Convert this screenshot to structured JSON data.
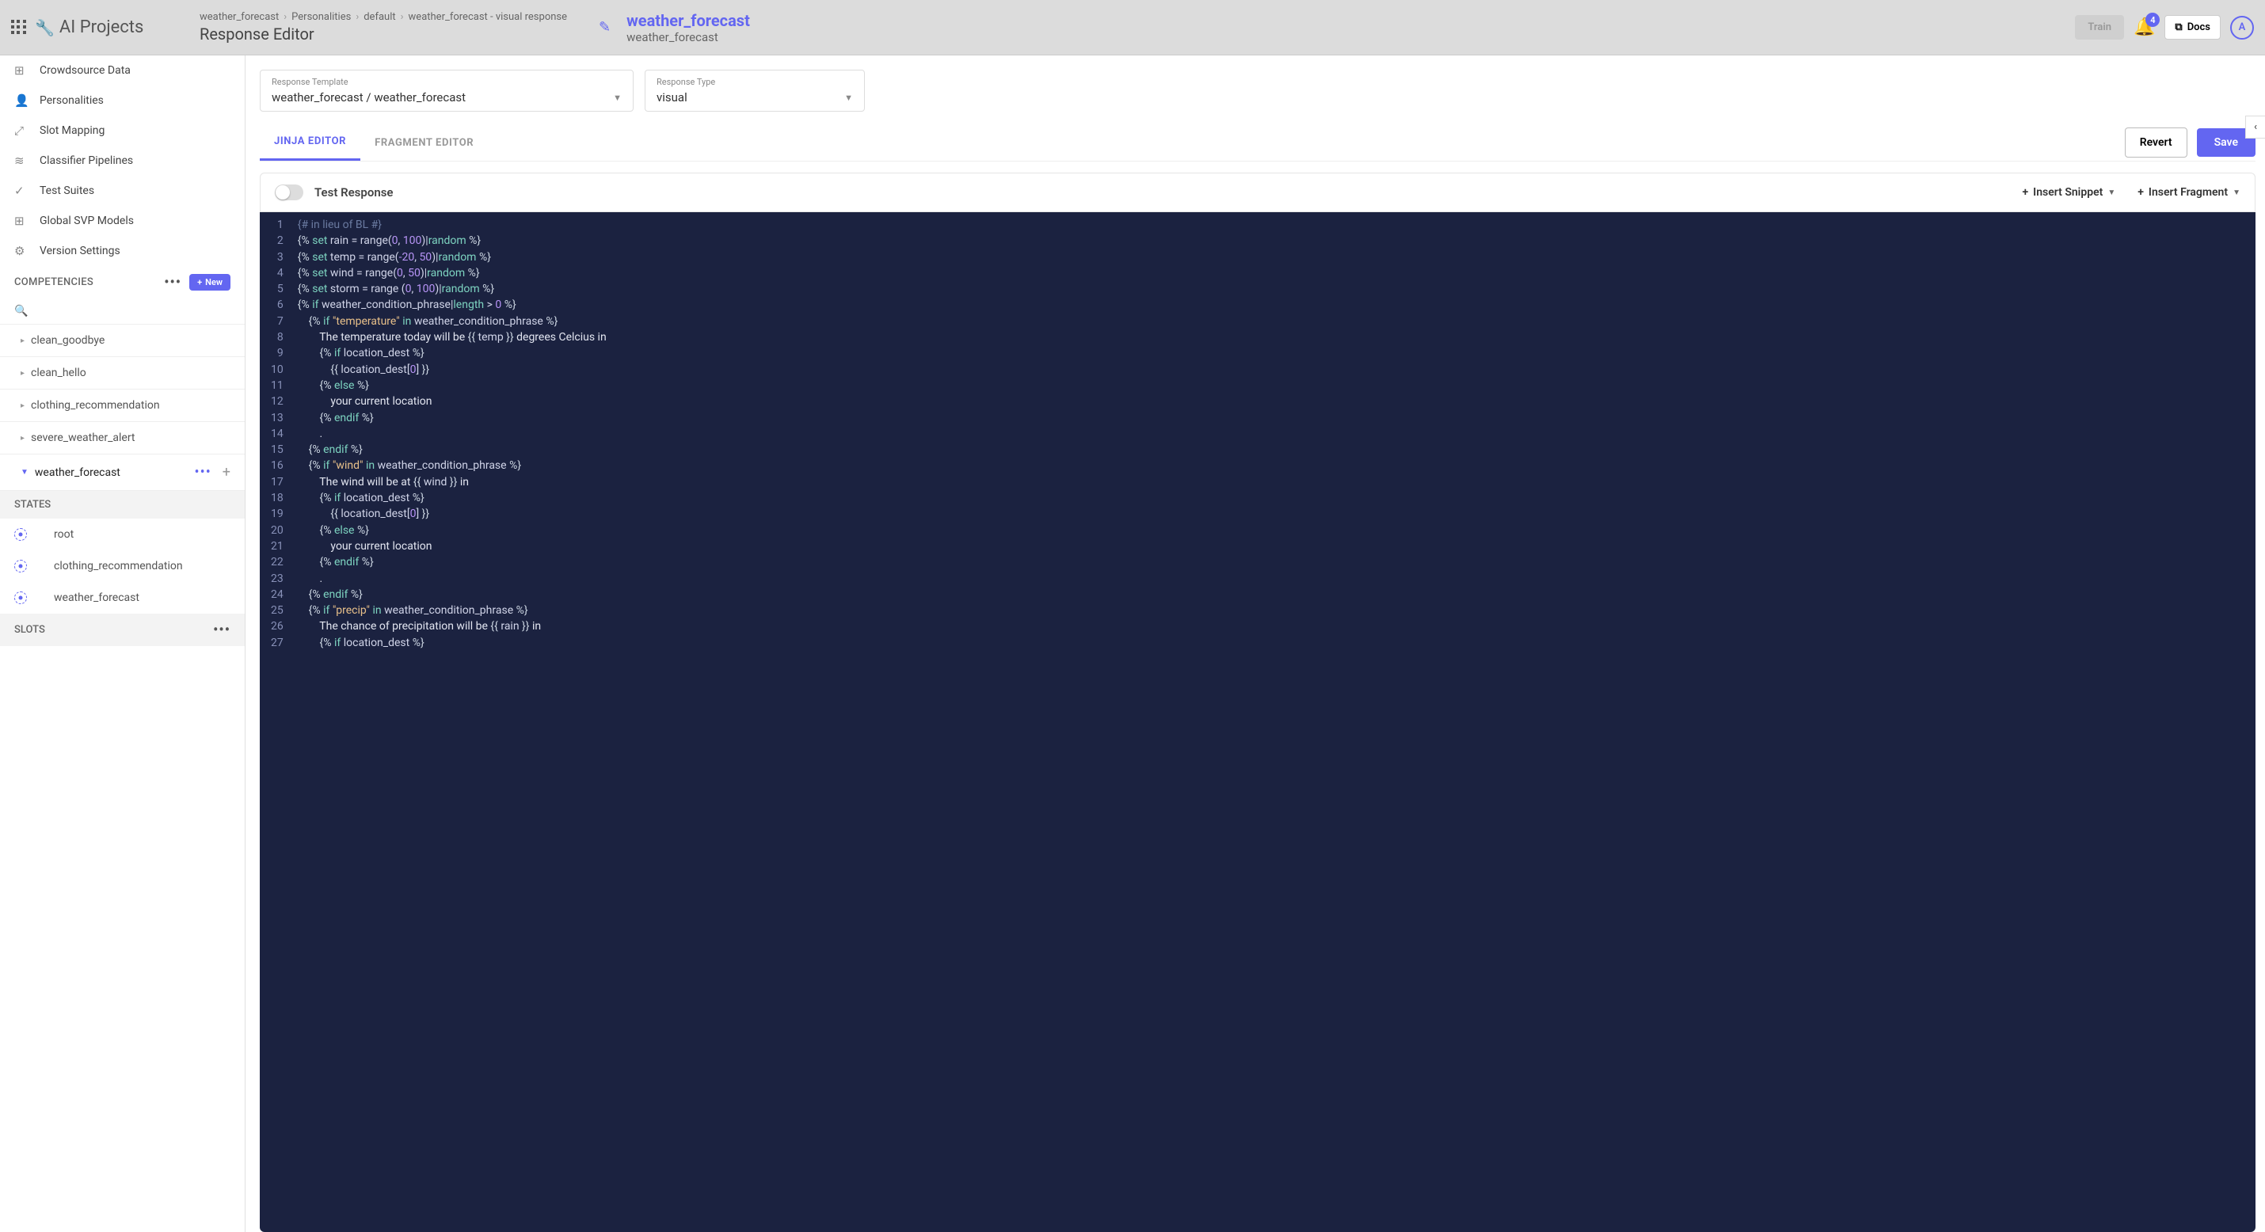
{
  "brand": "AI Projects",
  "breadcrumb": [
    "weather_forecast",
    "Personalities",
    "default",
    "weather_forecast - visual response"
  ],
  "page_title": "Response Editor",
  "wf": {
    "title": "weather_forecast",
    "sub": "weather_forecast"
  },
  "header": {
    "train": "Train",
    "docs": "Docs",
    "bell_badge": "4",
    "avatar": "A"
  },
  "sidebar": {
    "nav": [
      {
        "icon": "⊞",
        "label": "Crowdsource Data"
      },
      {
        "icon": "👤",
        "label": "Personalities"
      },
      {
        "icon": "⤢",
        "label": "Slot Mapping"
      },
      {
        "icon": "≋",
        "label": "Classifier Pipelines"
      },
      {
        "icon": "✓",
        "label": "Test Suites"
      },
      {
        "icon": "⊞",
        "label": "Global SVP Models"
      },
      {
        "icon": "⚙",
        "label": "Version Settings"
      }
    ],
    "competencies_label": "COMPETENCIES",
    "new_label": "New",
    "competencies": [
      {
        "label": "clean_goodbye",
        "expanded": false
      },
      {
        "label": "clean_hello",
        "expanded": false
      },
      {
        "label": "clothing_recommendation",
        "expanded": false
      },
      {
        "label": "severe_weather_alert",
        "expanded": false
      },
      {
        "label": "weather_forecast",
        "expanded": true
      }
    ],
    "states_label": "STATES",
    "states": [
      "root",
      "clothing_recommendation",
      "weather_forecast"
    ],
    "slots_label": "SLOTS"
  },
  "form": {
    "template_label": "Response Template",
    "template_value": "weather_forecast / weather_forecast",
    "type_label": "Response Type",
    "type_value": "visual"
  },
  "tabs": {
    "jinja": "JINJA EDITOR",
    "fragment": "FRAGMENT EDITOR"
  },
  "buttons": {
    "revert": "Revert",
    "save": "Save"
  },
  "toolbar": {
    "test": "Test Response",
    "insert_snippet": "Insert Snippet",
    "insert_fragment": "Insert Fragment"
  },
  "code_lines": [
    [
      {
        "c": "c-comment",
        "t": "{# in lieu of BL #}"
      }
    ],
    [
      {
        "c": "c-tag",
        "t": "{% "
      },
      {
        "c": "c-kw",
        "t": "set"
      },
      {
        "c": "c-var",
        "t": " rain = range("
      },
      {
        "c": "c-num",
        "t": "0"
      },
      {
        "c": "c-var",
        "t": ", "
      },
      {
        "c": "c-num",
        "t": "100"
      },
      {
        "c": "c-var",
        "t": ")|"
      },
      {
        "c": "c-filt",
        "t": "random"
      },
      {
        "c": "c-tag",
        "t": " %}"
      }
    ],
    [
      {
        "c": "c-tag",
        "t": "{% "
      },
      {
        "c": "c-kw",
        "t": "set"
      },
      {
        "c": "c-var",
        "t": " temp = range("
      },
      {
        "c": "c-num",
        "t": "-20"
      },
      {
        "c": "c-var",
        "t": ", "
      },
      {
        "c": "c-num",
        "t": "50"
      },
      {
        "c": "c-var",
        "t": ")|"
      },
      {
        "c": "c-filt",
        "t": "random"
      },
      {
        "c": "c-tag",
        "t": " %}"
      }
    ],
    [
      {
        "c": "c-tag",
        "t": "{% "
      },
      {
        "c": "c-kw",
        "t": "set"
      },
      {
        "c": "c-var",
        "t": " wind = range("
      },
      {
        "c": "c-num",
        "t": "0"
      },
      {
        "c": "c-var",
        "t": ", "
      },
      {
        "c": "c-num",
        "t": "50"
      },
      {
        "c": "c-var",
        "t": ")|"
      },
      {
        "c": "c-filt",
        "t": "random"
      },
      {
        "c": "c-tag",
        "t": " %}"
      }
    ],
    [
      {
        "c": "c-tag",
        "t": "{% "
      },
      {
        "c": "c-kw",
        "t": "set"
      },
      {
        "c": "c-var",
        "t": " storm = range ("
      },
      {
        "c": "c-num",
        "t": "0"
      },
      {
        "c": "c-var",
        "t": ", "
      },
      {
        "c": "c-num",
        "t": "100"
      },
      {
        "c": "c-var",
        "t": ")|"
      },
      {
        "c": "c-filt",
        "t": "random"
      },
      {
        "c": "c-tag",
        "t": " %}"
      }
    ],
    [
      {
        "c": "c-tag",
        "t": "{% "
      },
      {
        "c": "c-kw",
        "t": "if"
      },
      {
        "c": "c-var",
        "t": " weather_condition_phrase|"
      },
      {
        "c": "c-filt",
        "t": "length"
      },
      {
        "c": "c-var",
        "t": " > "
      },
      {
        "c": "c-num",
        "t": "0"
      },
      {
        "c": "c-tag",
        "t": " %}"
      }
    ],
    [
      {
        "c": "",
        "t": "    "
      },
      {
        "c": "c-tag",
        "t": "{% "
      },
      {
        "c": "c-kw",
        "t": "if"
      },
      {
        "c": "c-var",
        "t": " "
      },
      {
        "c": "c-str",
        "t": "\"temperature\""
      },
      {
        "c": "c-var",
        "t": " "
      },
      {
        "c": "c-kw",
        "t": "in"
      },
      {
        "c": "c-var",
        "t": " weather_condition_phrase "
      },
      {
        "c": "c-tag",
        "t": "%}"
      }
    ],
    [
      {
        "c": "",
        "t": "        "
      },
      {
        "c": "c-text",
        "t": "The temperature today will be "
      },
      {
        "c": "c-tag",
        "t": "{{ "
      },
      {
        "c": "c-var",
        "t": "temp"
      },
      {
        "c": "c-tag",
        "t": " }}"
      },
      {
        "c": "c-text",
        "t": " degrees Celcius in"
      }
    ],
    [
      {
        "c": "",
        "t": "        "
      },
      {
        "c": "c-tag",
        "t": "{% "
      },
      {
        "c": "c-kw",
        "t": "if"
      },
      {
        "c": "c-var",
        "t": " location_dest "
      },
      {
        "c": "c-tag",
        "t": "%}"
      }
    ],
    [
      {
        "c": "",
        "t": "            "
      },
      {
        "c": "c-tag",
        "t": "{{ "
      },
      {
        "c": "c-var",
        "t": "location_dest["
      },
      {
        "c": "c-num",
        "t": "0"
      },
      {
        "c": "c-var",
        "t": "]"
      },
      {
        "c": "c-tag",
        "t": " }}"
      }
    ],
    [
      {
        "c": "",
        "t": "        "
      },
      {
        "c": "c-tag",
        "t": "{% "
      },
      {
        "c": "c-kw",
        "t": "else"
      },
      {
        "c": "c-tag",
        "t": " %}"
      }
    ],
    [
      {
        "c": "",
        "t": "            "
      },
      {
        "c": "c-text",
        "t": "your current location"
      }
    ],
    [
      {
        "c": "",
        "t": "        "
      },
      {
        "c": "c-tag",
        "t": "{% "
      },
      {
        "c": "c-kw",
        "t": "endif"
      },
      {
        "c": "c-tag",
        "t": " %}"
      }
    ],
    [
      {
        "c": "",
        "t": "        "
      },
      {
        "c": "c-text",
        "t": "."
      }
    ],
    [
      {
        "c": "",
        "t": "    "
      },
      {
        "c": "c-tag",
        "t": "{% "
      },
      {
        "c": "c-kw",
        "t": "endif"
      },
      {
        "c": "c-tag",
        "t": " %}"
      }
    ],
    [
      {
        "c": "",
        "t": "    "
      },
      {
        "c": "c-tag",
        "t": "{% "
      },
      {
        "c": "c-kw",
        "t": "if"
      },
      {
        "c": "c-var",
        "t": " "
      },
      {
        "c": "c-str",
        "t": "\"wind\""
      },
      {
        "c": "c-var",
        "t": " "
      },
      {
        "c": "c-kw",
        "t": "in"
      },
      {
        "c": "c-var",
        "t": " weather_condition_phrase "
      },
      {
        "c": "c-tag",
        "t": "%}"
      }
    ],
    [
      {
        "c": "",
        "t": "        "
      },
      {
        "c": "c-text",
        "t": "The wind will be at "
      },
      {
        "c": "c-tag",
        "t": "{{ "
      },
      {
        "c": "c-var",
        "t": "wind"
      },
      {
        "c": "c-tag",
        "t": " }}"
      },
      {
        "c": "c-text",
        "t": " in"
      }
    ],
    [
      {
        "c": "",
        "t": "        "
      },
      {
        "c": "c-tag",
        "t": "{% "
      },
      {
        "c": "c-kw",
        "t": "if"
      },
      {
        "c": "c-var",
        "t": " location_dest "
      },
      {
        "c": "c-tag",
        "t": "%}"
      }
    ],
    [
      {
        "c": "",
        "t": "            "
      },
      {
        "c": "c-tag",
        "t": "{{ "
      },
      {
        "c": "c-var",
        "t": "location_dest["
      },
      {
        "c": "c-num",
        "t": "0"
      },
      {
        "c": "c-var",
        "t": "]"
      },
      {
        "c": "c-tag",
        "t": " }}"
      }
    ],
    [
      {
        "c": "",
        "t": "        "
      },
      {
        "c": "c-tag",
        "t": "{% "
      },
      {
        "c": "c-kw",
        "t": "else"
      },
      {
        "c": "c-tag",
        "t": " %}"
      }
    ],
    [
      {
        "c": "",
        "t": "            "
      },
      {
        "c": "c-text",
        "t": "your current location"
      }
    ],
    [
      {
        "c": "",
        "t": "        "
      },
      {
        "c": "c-tag",
        "t": "{% "
      },
      {
        "c": "c-kw",
        "t": "endif"
      },
      {
        "c": "c-tag",
        "t": " %}"
      }
    ],
    [
      {
        "c": "",
        "t": "        "
      },
      {
        "c": "c-text",
        "t": "."
      }
    ],
    [
      {
        "c": "",
        "t": "    "
      },
      {
        "c": "c-tag",
        "t": "{% "
      },
      {
        "c": "c-kw",
        "t": "endif"
      },
      {
        "c": "c-tag",
        "t": " %}"
      }
    ],
    [
      {
        "c": "",
        "t": "    "
      },
      {
        "c": "c-tag",
        "t": "{% "
      },
      {
        "c": "c-kw",
        "t": "if"
      },
      {
        "c": "c-var",
        "t": " "
      },
      {
        "c": "c-str",
        "t": "\"precip\""
      },
      {
        "c": "c-var",
        "t": " "
      },
      {
        "c": "c-kw",
        "t": "in"
      },
      {
        "c": "c-var",
        "t": " weather_condition_phrase "
      },
      {
        "c": "c-tag",
        "t": "%}"
      }
    ],
    [
      {
        "c": "",
        "t": "        "
      },
      {
        "c": "c-text",
        "t": "The chance of precipitation will be "
      },
      {
        "c": "c-tag",
        "t": "{{ "
      },
      {
        "c": "c-var",
        "t": "rain"
      },
      {
        "c": "c-tag",
        "t": " }}"
      },
      {
        "c": "c-text",
        "t": " in"
      }
    ],
    [
      {
        "c": "",
        "t": "        "
      },
      {
        "c": "c-tag",
        "t": "{% "
      },
      {
        "c": "c-kw",
        "t": "if"
      },
      {
        "c": "c-var",
        "t": " location_dest "
      },
      {
        "c": "c-tag",
        "t": "%}"
      }
    ]
  ]
}
